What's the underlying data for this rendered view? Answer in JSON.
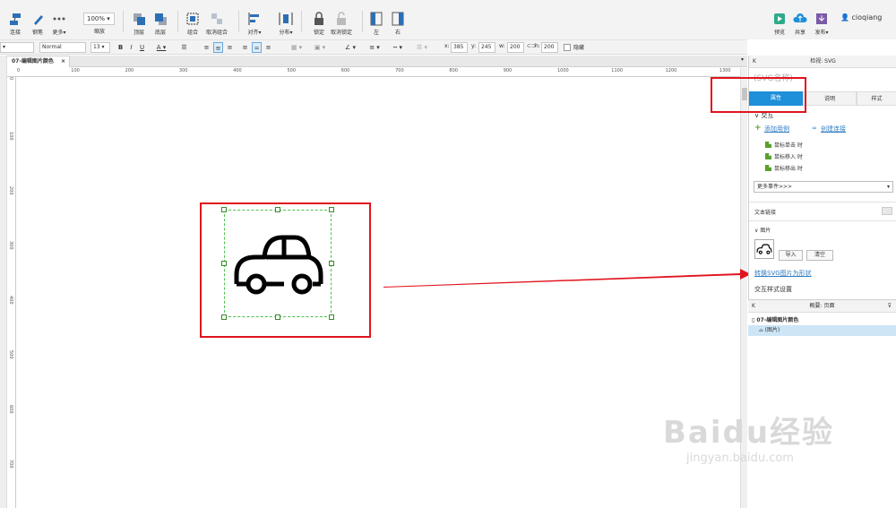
{
  "toolbar": {
    "buttons": [
      {
        "label": "连接"
      },
      {
        "label": "钢笔"
      },
      {
        "label": "更多▾"
      },
      {
        "label": "缩放"
      },
      {
        "label": "顶层"
      },
      {
        "label": "底层"
      },
      {
        "label": "组合"
      },
      {
        "label": "取消组合"
      },
      {
        "label": "对齐▾"
      },
      {
        "label": "分布▾"
      },
      {
        "label": "锁定"
      },
      {
        "label": "取消锁定"
      },
      {
        "label": "左"
      },
      {
        "label": "右"
      },
      {
        "label": "预览"
      },
      {
        "label": "共享"
      },
      {
        "label": "发布▾"
      }
    ],
    "zoom": "100%",
    "user": "cioqiang"
  },
  "formatbar": {
    "style": "Normal",
    "font_size": "13",
    "x_label": "x:",
    "x": "385",
    "y_label": "y:",
    "y": "245",
    "w_label": "w:",
    "w": "200",
    "h_label": "h:",
    "h": "200",
    "hide_label": "隐藏"
  },
  "tab": {
    "title": "07-编辑图片颜色"
  },
  "ruler": {
    "top": [
      "0",
      "100",
      "200",
      "300",
      "400",
      "500",
      "600",
      "700",
      "800",
      "900",
      "1000",
      "1100",
      "1200",
      "1300"
    ],
    "left": [
      "0",
      "100",
      "200",
      "300",
      "400",
      "500",
      "600",
      "700"
    ]
  },
  "panel": {
    "header": "检视: SVG",
    "name_placeholder": "(SVG名称)",
    "tabs": [
      "属性",
      "说明",
      "样式"
    ],
    "interaction_title": "交互",
    "add_case": "添加用例",
    "create_link": "创建连接",
    "events": [
      "鼠标单击 时",
      "鼠标移入 时",
      "鼠标移出 时"
    ],
    "more_events": "更多事件>>>",
    "text_link": "文本链接",
    "image_title": "图片",
    "import": "导入",
    "clear": "清空",
    "convert_link": "转换SVG图片为形状",
    "interaction_style": "交互样式设置"
  },
  "outline": {
    "header": "概要: 页面",
    "page": "07-编辑图片颜色",
    "item": "(图片)"
  },
  "watermark": {
    "brand": "Baidu经验",
    "url": "jingyan.baidu.com"
  },
  "colors": {
    "accent": "#1e8fd9",
    "highlight": "#e0141e",
    "selection": "#4cc24c"
  }
}
